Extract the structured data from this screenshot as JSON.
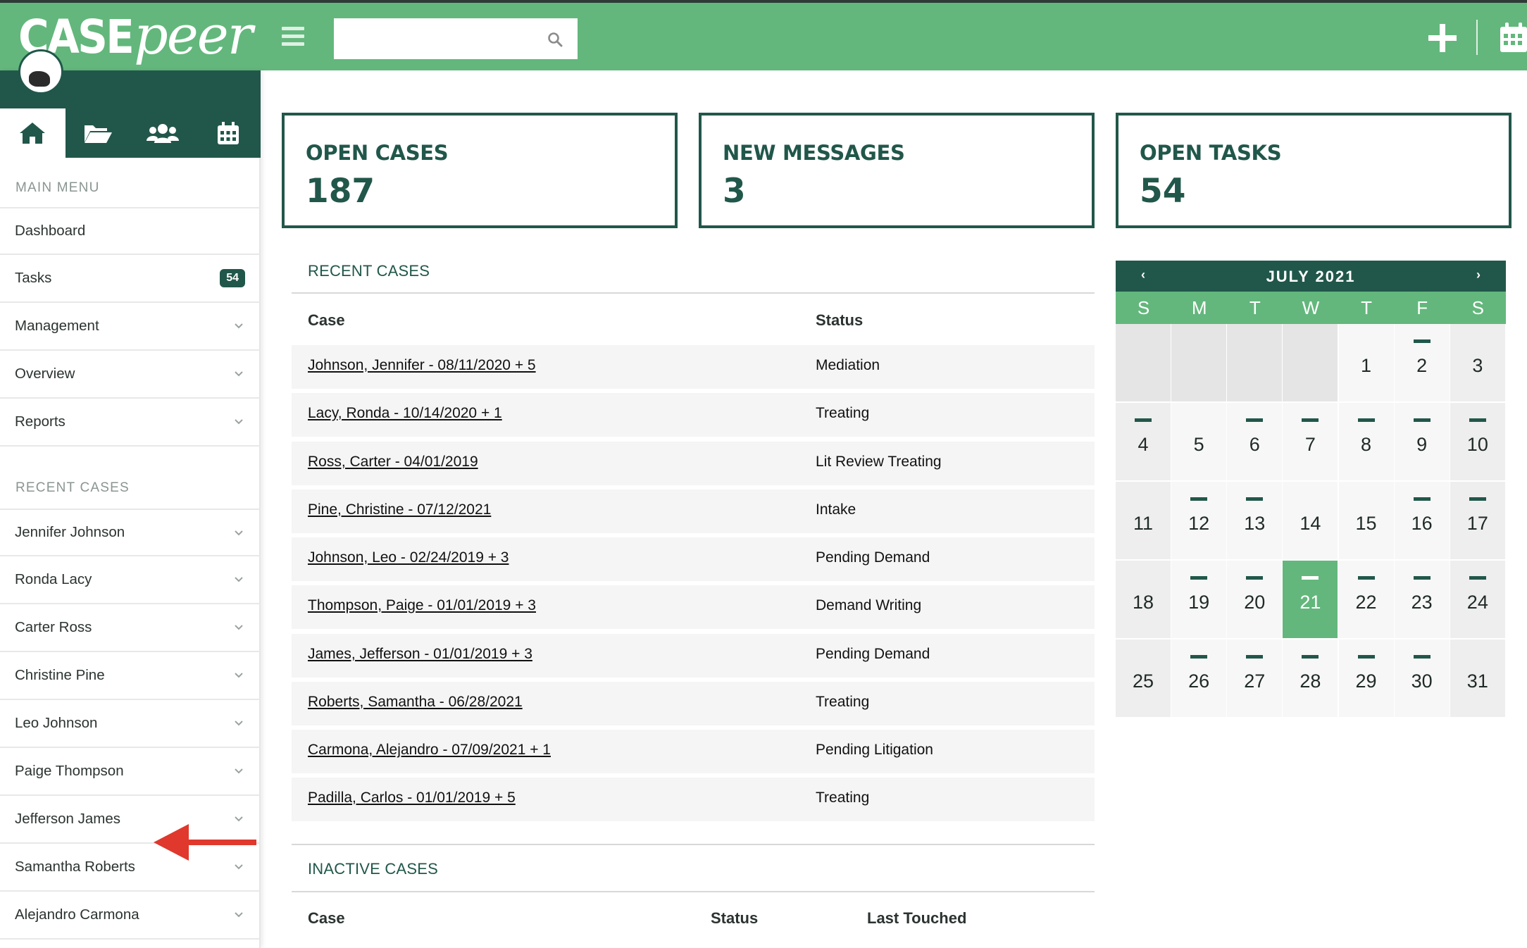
{
  "app": {
    "logo_case": "CASE",
    "logo_peer": "peer"
  },
  "search": {
    "placeholder": ""
  },
  "sidebar": {
    "main_menu_label": "MAIN MENU",
    "main_menu": [
      {
        "label": "Dashboard"
      },
      {
        "label": "Tasks",
        "badge": "54"
      },
      {
        "label": "Management"
      },
      {
        "label": "Overview"
      },
      {
        "label": "Reports"
      }
    ],
    "recent_label": "RECENT CASES",
    "recent": [
      {
        "label": "Jennifer Johnson"
      },
      {
        "label": "Ronda Lacy"
      },
      {
        "label": "Carter Ross"
      },
      {
        "label": "Christine Pine"
      },
      {
        "label": "Leo Johnson"
      },
      {
        "label": "Paige Thompson"
      },
      {
        "label": "Jefferson James"
      },
      {
        "label": "Samantha Roberts"
      },
      {
        "label": "Alejandro Carmona"
      }
    ]
  },
  "cards": [
    {
      "title": "OPEN CASES",
      "value": "187"
    },
    {
      "title": "NEW MESSAGES",
      "value": "3"
    },
    {
      "title": "OPEN TASKS",
      "value": "54"
    }
  ],
  "recent_cases": {
    "title": "RECENT CASES",
    "headers": {
      "case": "Case",
      "status": "Status"
    },
    "rows": [
      {
        "case": "Johnson, Jennifer - 08/11/2020 + 5",
        "status": "Mediation"
      },
      {
        "case": "Lacy, Ronda - 10/14/2020 + 1",
        "status": "Treating"
      },
      {
        "case": "Ross, Carter - 04/01/2019",
        "status": "Lit Review Treating"
      },
      {
        "case": "Pine, Christine - 07/12/2021",
        "status": "Intake"
      },
      {
        "case": "Johnson, Leo - 02/24/2019 + 3",
        "status": "Pending Demand"
      },
      {
        "case": "Thompson, Paige - 01/01/2019 + 3",
        "status": "Demand Writing"
      },
      {
        "case": "James, Jefferson - 01/01/2019 + 3",
        "status": "Pending Demand"
      },
      {
        "case": "Roberts, Samantha - 06/28/2021",
        "status": "Treating"
      },
      {
        "case": "Carmona, Alejandro - 07/09/2021 + 1",
        "status": "Pending Litigation"
      },
      {
        "case": "Padilla, Carlos - 01/01/2019 + 5",
        "status": "Treating"
      }
    ]
  },
  "inactive_cases": {
    "title": "INACTIVE CASES",
    "headers": {
      "case": "Case",
      "status": "Status",
      "last_touched": "Last Touched"
    }
  },
  "calendar": {
    "month": "JULY 2021",
    "prev": "‹",
    "next": "›",
    "weekdays": [
      "S",
      "M",
      "T",
      "W",
      "T",
      "F",
      "S"
    ],
    "leading_blanks": 4,
    "days": 31,
    "today": 21,
    "marked_days": [
      2,
      4,
      6,
      7,
      8,
      9,
      10,
      12,
      13,
      16,
      17,
      19,
      20,
      21,
      22,
      23,
      24,
      26,
      27,
      28,
      29,
      30
    ]
  },
  "colors": {
    "primary_dark": "#21574a",
    "primary_light": "#63b77c",
    "arrow": "#e0382c"
  }
}
